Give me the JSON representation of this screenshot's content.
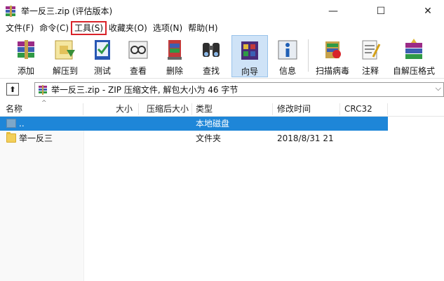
{
  "window": {
    "title": "举一反三.zip (评估版本)",
    "minimize_glyph": "—",
    "maximize_glyph": "☐",
    "close_glyph": "✕"
  },
  "menu": [
    "文件(F)",
    "命令(C)",
    "工具(S)",
    "收藏夹(O)",
    "选项(N)",
    "帮助(H)"
  ],
  "highlighted_menu": "工具(S)",
  "highlight_color": "#d8232a",
  "toolbar": [
    {
      "label": "添加",
      "icon": "add-archive-icon"
    },
    {
      "label": "解压到",
      "icon": "extract-to-icon"
    },
    {
      "label": "测试",
      "icon": "test-icon"
    },
    {
      "label": "查看",
      "icon": "view-icon"
    },
    {
      "label": "删除",
      "icon": "delete-icon"
    },
    {
      "label": "查找",
      "icon": "find-binoculars-icon"
    },
    {
      "label": "向导",
      "icon": "wizard-icon"
    },
    {
      "label": "信息",
      "icon": "info-icon"
    },
    {
      "label": "扫描病毒",
      "icon": "virus-scan-icon"
    },
    {
      "label": "注释",
      "icon": "comment-icon"
    },
    {
      "label": "自解压格式",
      "icon": "sfx-icon"
    }
  ],
  "pathbar": {
    "up_glyph": "⬆",
    "path_text": "举一反三.zip - ZIP 压缩文件, 解包大小为 46 字节",
    "dropdown_glyph": "⌵"
  },
  "columns": [
    "名称",
    "大小",
    "压缩后大小",
    "类型",
    "修改时间",
    "CRC32"
  ],
  "rows": [
    {
      "name": "..",
      "size": "",
      "packed": "",
      "type": "本地磁盘",
      "modified": "",
      "crc": "",
      "selected": true,
      "icon": "drive-icon"
    },
    {
      "name": "举一反三",
      "size": "",
      "packed": "",
      "type": "文件夹",
      "modified": "2018/8/31 21",
      "crc": "",
      "selected": false,
      "icon": "folder-icon"
    }
  ],
  "colors": {
    "selection": "#1e86d8",
    "active_tool": "#cfe3f7"
  }
}
